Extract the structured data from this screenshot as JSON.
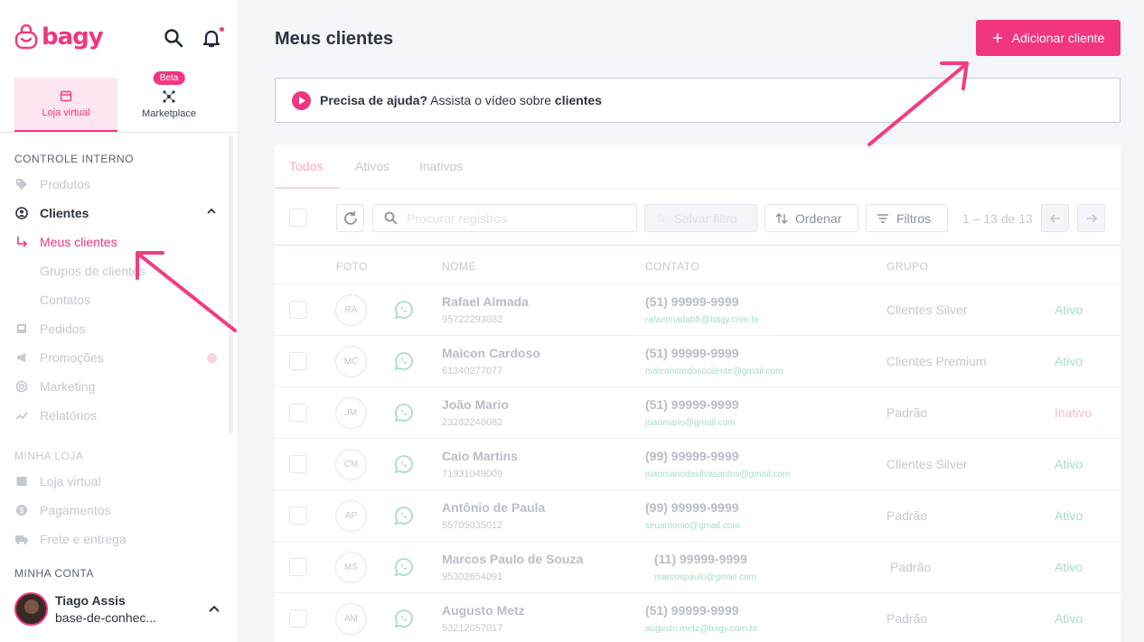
{
  "brand": {
    "name": "bagy",
    "accent": "#f2357f"
  },
  "store_tabs": [
    {
      "label": "Loja virtual",
      "icon": "store-icon",
      "active": true
    },
    {
      "label": "Marketplace",
      "icon": "marketplace-icon",
      "badge": "Beta",
      "active": false
    }
  ],
  "sidebar": {
    "section_internal": "CONTROLE INTERNO",
    "items": [
      {
        "label": "Produtos",
        "icon": "tag-icon"
      },
      {
        "label": "Clientes",
        "icon": "user-circle-icon"
      },
      {
        "label": "Meus clientes",
        "icon": "subitem-arrow-icon"
      },
      {
        "label": "Grupos de clientes"
      },
      {
        "label": "Contatos"
      },
      {
        "label": "Pedidos",
        "icon": "inbox-icon"
      },
      {
        "label": "Promoções",
        "icon": "megaphone-icon"
      },
      {
        "label": "Marketing",
        "icon": "target-icon"
      },
      {
        "label": "Relatórios",
        "icon": "chart-line-icon"
      }
    ],
    "section_store": "MINHA LOJA",
    "store_items": [
      {
        "label": "Loja virtual",
        "icon": "store-icon"
      },
      {
        "label": "Pagamentos",
        "icon": "dollar-icon"
      },
      {
        "label": "Frete e entrega",
        "icon": "truck-icon"
      }
    ],
    "section_account": "MINHA CONTA",
    "account": {
      "name": "Tiago Assis",
      "sub": "base-de-conhec..."
    }
  },
  "main": {
    "title": "Meus clientes",
    "add_button": "Adicionar cliente",
    "help": {
      "bold": "Precisa de ajuda?",
      "text": " Assista o vídeo sobre ",
      "link": "clientes"
    },
    "tabs": [
      "Todos",
      "Ativos",
      "Inativos"
    ],
    "search_placeholder": "Procurar registros",
    "save_filter": "Salvar filtro",
    "order": "Ordenar",
    "filters": "Filtros",
    "pagination": "1 – 13 de 13",
    "columns": {
      "photo": "FOTO",
      "name": "NOME",
      "contact": "CONTATO",
      "group": "GRUPO"
    },
    "rows": [
      {
        "initials": "RA",
        "name": "Rafael Almada",
        "id": "95722293032",
        "phone": "(51) 99999-9999",
        "email": "rafaelmadabfr@bagy.com.br",
        "group": "Clientes Silver",
        "status": "Ativo"
      },
      {
        "initials": "MC",
        "name": "Maicon Cardoso",
        "id": "61340277077",
        "phone": "(51) 99999-9999",
        "email": "maiconcardosocliente@gmail.com",
        "group": "Clientes Premium",
        "status": "Ativo"
      },
      {
        "initials": "JM",
        "name": "João Mario",
        "id": "23282240082",
        "phone": "(51) 99999-9999",
        "email": "joaomario@gmail.com",
        "group": "Padrão",
        "status": "Inativo"
      },
      {
        "initials": "CM",
        "name": "Caio Martins",
        "id": "71931049009",
        "phone": "(99) 99999-9999",
        "email": "joaomariodasilvasantos@gmail.com",
        "group": "Clientes Silver",
        "status": "Ativo"
      },
      {
        "initials": "AP",
        "name": "Antônio de Paula",
        "id": "55705035012",
        "phone": "(99) 99999-9999",
        "email": "seuantonio@gmail.com",
        "group": "Padrão",
        "status": "Ativo"
      },
      {
        "initials": "MS",
        "name": "Marcos Paulo de Souza",
        "id": "95302654091",
        "phone": "(11) 99999-9999",
        "email": "marcospaulo@gmail.com",
        "group": "Padrão",
        "status": "Ativo"
      },
      {
        "initials": "AM",
        "name": "Augusto Metz",
        "id": "53212057017",
        "phone": "(51) 99999-9999",
        "email": "augusto.metz@bagy.com.br",
        "group": "Padrão",
        "status": "Ativo"
      }
    ]
  }
}
